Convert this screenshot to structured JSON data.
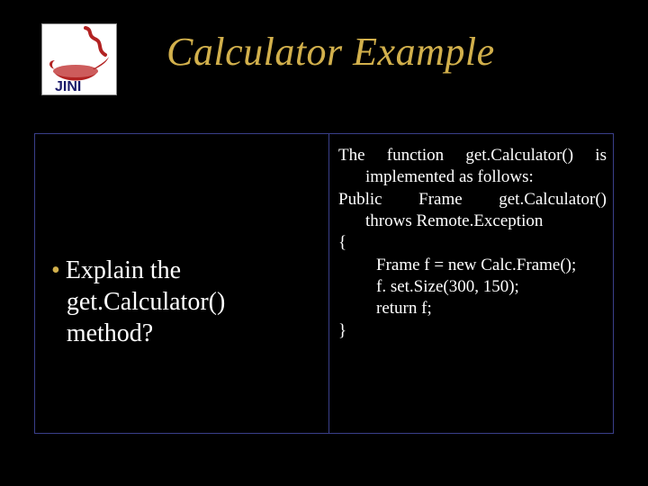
{
  "title": "Calculator Example",
  "logo": {
    "brand": "JINI"
  },
  "left": {
    "bullet_line1": "Explain the",
    "bullet_line2": "get.Calculator()",
    "bullet_line3": "method?"
  },
  "right": {
    "l1": "The function get.Calculator() is",
    "l2": "implemented as follows:",
    "l3": "Public Frame get.Calculator()",
    "l4": "throws Remote.Exception",
    "l5": "{",
    "l6": "Frame f = new Calc.Frame();",
    "l7": "f. set.Size(300, 150);",
    "l8": " return f;",
    "l9": "}"
  }
}
